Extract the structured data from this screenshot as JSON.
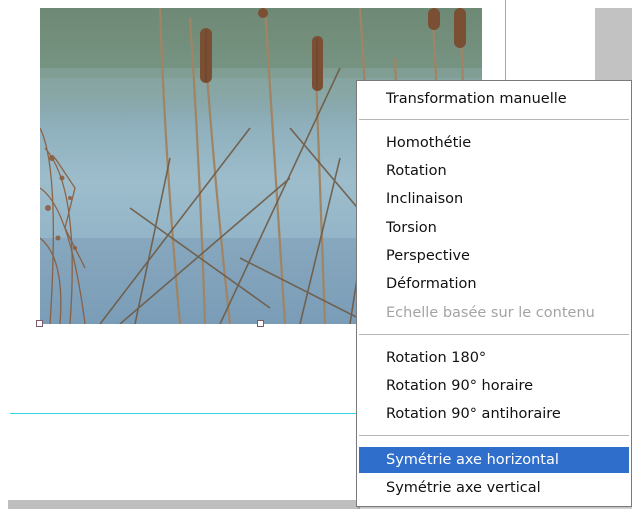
{
  "context_menu": {
    "header_item": "Transformation manuelle",
    "transform_items": [
      {
        "label": "Homothétie",
        "enabled": true
      },
      {
        "label": "Rotation",
        "enabled": true
      },
      {
        "label": "Inclinaison",
        "enabled": true
      },
      {
        "label": "Torsion",
        "enabled": true
      },
      {
        "label": "Perspective",
        "enabled": true
      },
      {
        "label": "Déformation",
        "enabled": true
      },
      {
        "label": "Echelle basée sur le contenu",
        "enabled": false
      }
    ],
    "rotation_items": [
      {
        "label": "Rotation 180°"
      },
      {
        "label": "Rotation 90° horaire"
      },
      {
        "label": "Rotation 90° antihoraire"
      }
    ],
    "symmetry_items": [
      {
        "label": "Symétrie axe horizontal",
        "selected": true
      },
      {
        "label": "Symétrie axe vertical",
        "selected": false
      }
    ],
    "colors": {
      "highlight": "#2f6fcb",
      "disabled_text": "#a4a4a4"
    }
  },
  "canvas": {
    "guide_color": "#34d6e4"
  }
}
